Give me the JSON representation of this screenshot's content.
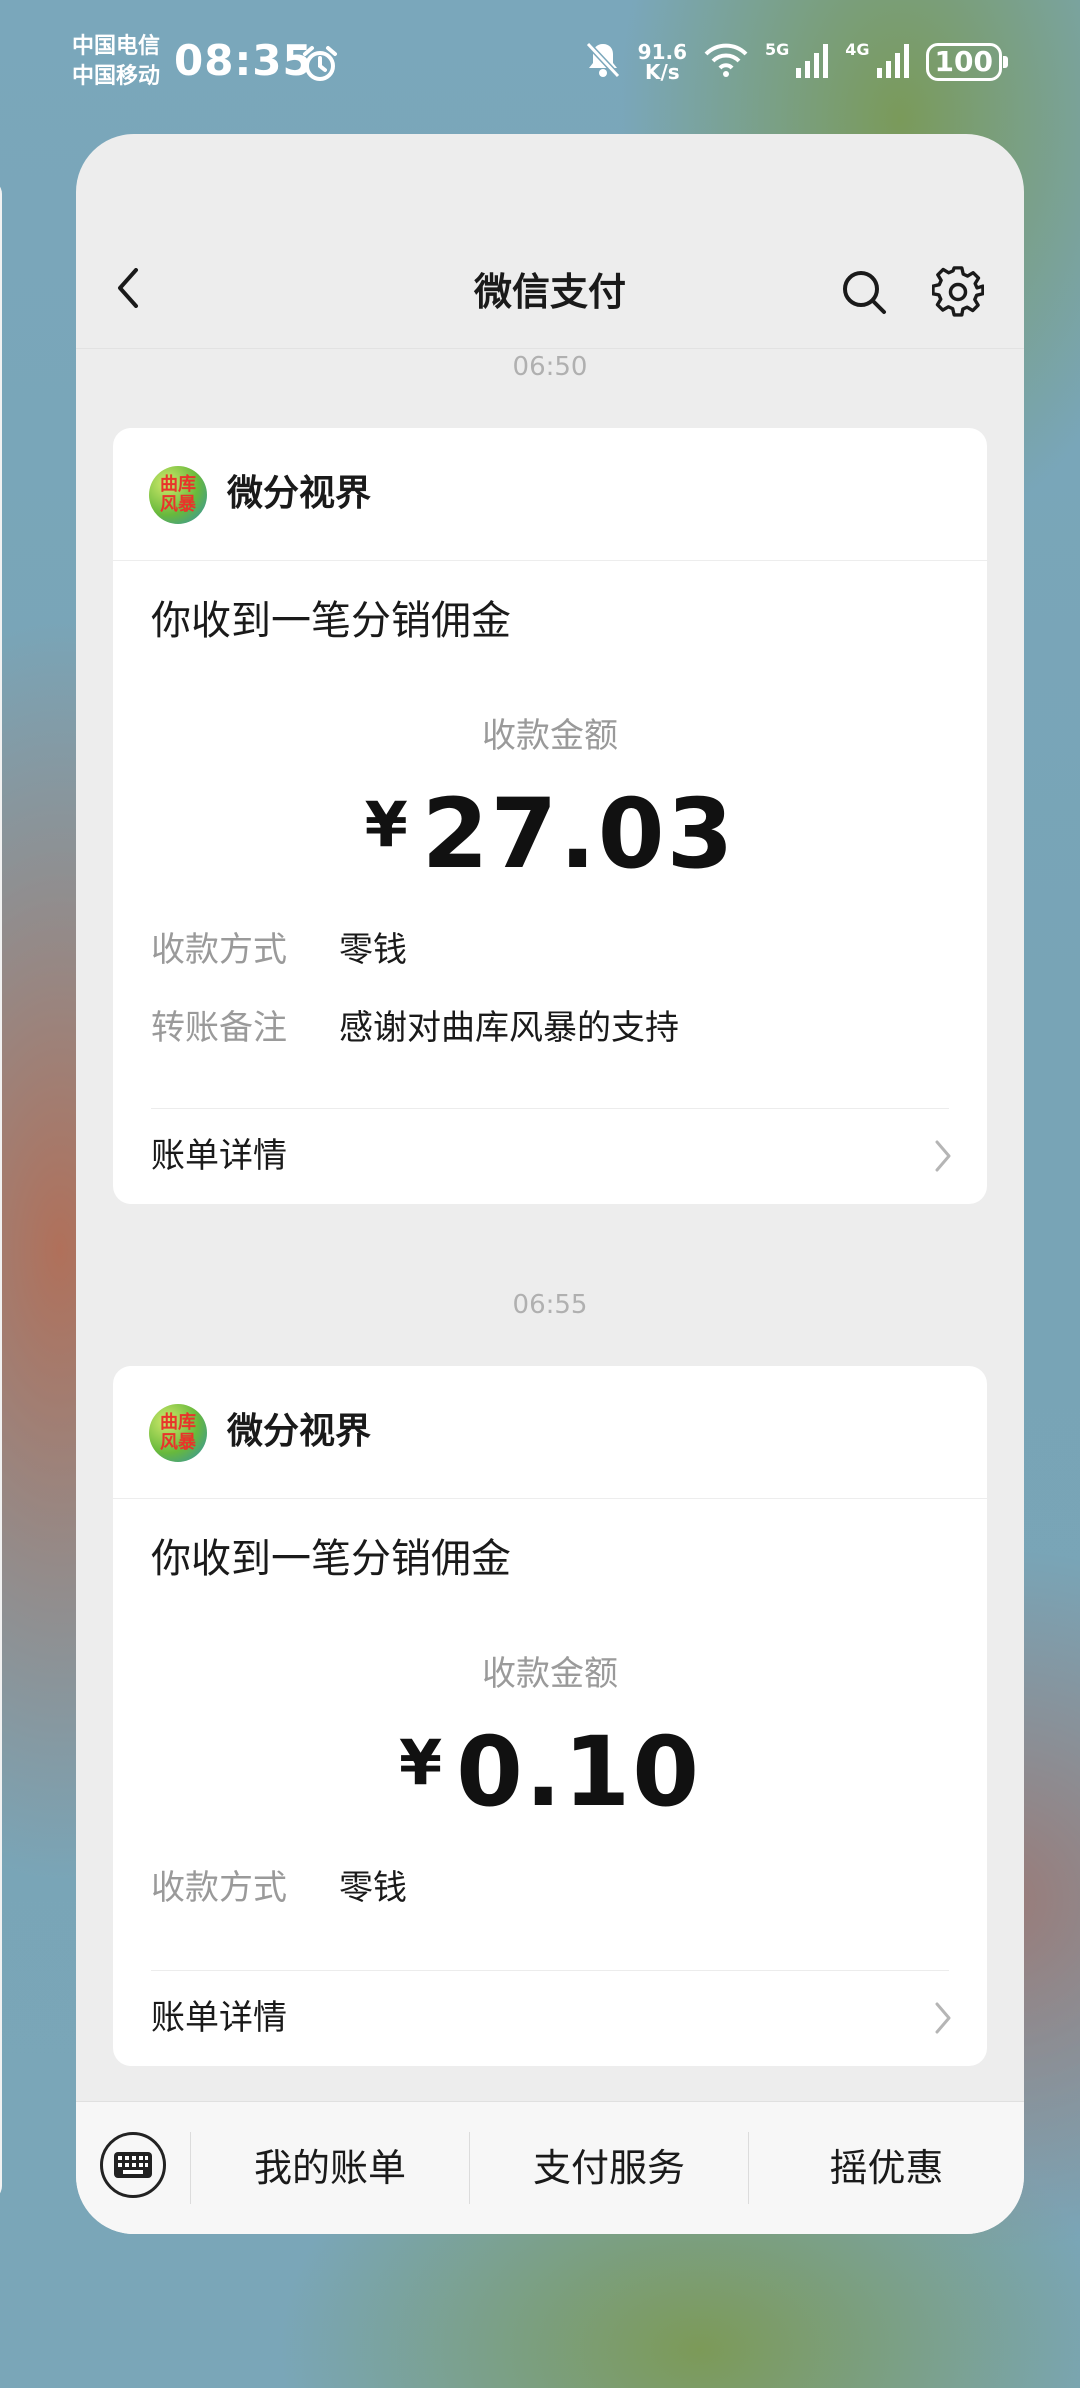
{
  "status_bar": {
    "carrier_1": "中国电信",
    "carrier_2": "中国移动",
    "time": "08:35",
    "net_speed_value": "91.6",
    "net_speed_unit": "K/s",
    "signal_1_label": "5G",
    "signal_2_label": "4G",
    "battery": "100"
  },
  "header": {
    "title": "微信支付"
  },
  "messages": [
    {
      "timestamp": "06:50",
      "sender": "微分视界",
      "avatar_text": "曲库风暴",
      "title": "你收到一笔分销佣金",
      "amount_label": "收款金额",
      "currency": "¥",
      "amount": "27.03",
      "rows": [
        {
          "key": "收款方式",
          "value": "零钱"
        },
        {
          "key": "转账备注",
          "value": "感谢对曲库风暴的支持"
        }
      ],
      "detail_label": "账单详情"
    },
    {
      "timestamp": "06:55",
      "sender": "微分视界",
      "avatar_text": "曲库风暴",
      "title": "你收到一笔分销佣金",
      "amount_label": "收款金额",
      "currency": "¥",
      "amount": "0.10",
      "rows": [
        {
          "key": "收款方式",
          "value": "零钱"
        }
      ],
      "detail_label": "账单详情"
    }
  ],
  "bottom_menu": {
    "items": [
      "我的账单",
      "支付服务",
      "摇优惠"
    ]
  }
}
